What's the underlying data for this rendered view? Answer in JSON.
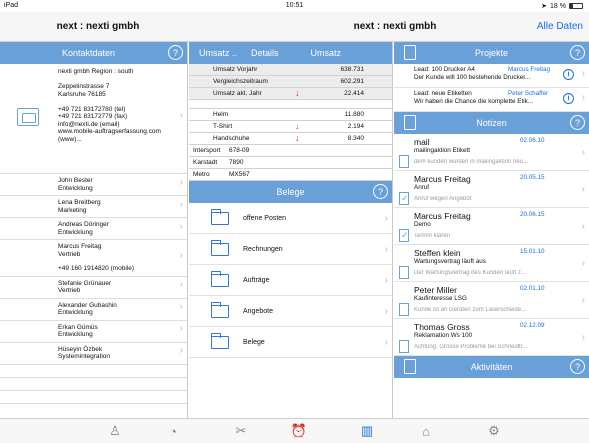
{
  "status": {
    "device": "iPad",
    "time": "10:51",
    "battery": "18 %"
  },
  "nav": {
    "left_title": "next : nexti gmbh",
    "center_title": "next : nexti gmbh",
    "all_data_button": "Alle Daten"
  },
  "kontakt": {
    "header": "Kontaktdaten",
    "company_lines": [
      "nexti gmbh Region : south",
      "",
      "Zeppelinstrasse 7",
      "Karlsruhe 76185",
      "",
      "+49 721 83172780 (tel)",
      "+49 721 83172779 (fax)",
      "info@nexti.de (email)",
      "www.mobile-auftragserfassung.com",
      "(www)..."
    ],
    "contacts": [
      {
        "name": "John Bester",
        "role": "Entwicklung"
      },
      {
        "name": "Lena Breitberg",
        "role": "Marketing"
      },
      {
        "name": "Andreas Döringer",
        "role": "Entwicklung"
      },
      {
        "name": "Marcus Freitag",
        "role": "Vertrieb",
        "extra": "+49 160 1914820 (mobile)"
      },
      {
        "name": "Stefanie Grünauer",
        "role": "Vertrieb"
      },
      {
        "name": "Alexander Gubashin",
        "role": "Entwicklung"
      },
      {
        "name": "Erkan Gümüs",
        "role": "Entwicklung"
      },
      {
        "name": "Hüseyin Özbek",
        "role": "Systemintegration"
      }
    ]
  },
  "umsatz": {
    "tabs": [
      "Umsatz ..",
      "Details",
      "Umsatz"
    ],
    "rows": [
      {
        "label": "Umsatz Vorjahr",
        "value": "638.731",
        "down": false
      },
      {
        "label": "Vergleichszeitraum",
        "value": "602.291",
        "down": false
      },
      {
        "label": "Umsatz akt. Jahr",
        "value": "22.414",
        "down": true
      }
    ],
    "products": [
      {
        "label": "Helm",
        "value": "11.880",
        "down": false
      },
      {
        "label": "T-Shirt",
        "value": "2.194",
        "down": true
      },
      {
        "label": "Handschuhe",
        "value": "8.340",
        "down": true
      }
    ],
    "kv": [
      {
        "k": "Intersport",
        "v": "678-09"
      },
      {
        "k": "Karstadt",
        "v": "7890"
      },
      {
        "k": "Metro",
        "v": "MX567"
      }
    ]
  },
  "belege": {
    "header": "Belege",
    "items": [
      "offene Posten",
      "Rechnungen",
      "Aufträge",
      "Angebote",
      "Belege"
    ]
  },
  "projekte": {
    "header": "Projekte",
    "items": [
      {
        "lead": "Lead: 100 Drucker A4",
        "owner": "Marcus Freitag",
        "desc": "Der Kunde will 100 bestehende Drucker..."
      },
      {
        "lead": "Lead: neue Etiketten",
        "owner": "Peter Schaffer",
        "desc": "Wir haben die Chance die komplette Etik..."
      }
    ]
  },
  "notizen": {
    "header": "Notizen",
    "items": [
      {
        "title": "mail",
        "date": "02.06.10",
        "sub": "mailingaktion Etikett",
        "preview": "dem kunden wurden in mailingaktion neu...",
        "checked": false
      },
      {
        "title": "Marcus Freitag",
        "date": "20.05.15",
        "sub": "Anruf",
        "preview": "Anruf wegen Angebot",
        "checked": true
      },
      {
        "title": "Marcus Freitag",
        "date": "20.06.15",
        "sub": "Demo",
        "preview": "Termin klären",
        "checked": true
      },
      {
        "title": "Steffen klein",
        "date": "15.01.10",
        "sub": "Wartungsvertrag läuft aus",
        "preview": "Der Wartungsvertrag des Kunden läuft z...",
        "checked": false
      },
      {
        "title": "Peter Miller",
        "date": "02.01.10",
        "sub": "Kaufinteresse LSG",
        "preview": "Kunde ist an Geräten zum Laserscheide...",
        "checked": false
      },
      {
        "title": "Thomas Gross",
        "date": "02.12.09",
        "sub": "Reklamation Ws 100",
        "preview": "Achtung. Grosse Probleme bei Schneidtr...",
        "checked": false
      }
    ]
  },
  "aktivitaeten": {
    "header": "Aktivitäten"
  },
  "help_glyph": "?",
  "info_glyph": "i",
  "chevron_glyph": "›",
  "down_arrow_glyph": "↓",
  "tabbar": {
    "icons": [
      "person-icon",
      "speedometer-icon",
      "tools-icon",
      "alarm-clock-icon",
      "bar-chart-icon",
      "shopping-bag-icon",
      "gear-icon"
    ],
    "active_index": 4
  }
}
